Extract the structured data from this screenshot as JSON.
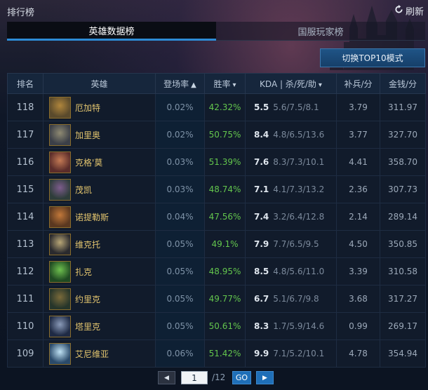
{
  "header": {
    "title": "排行榜",
    "refresh_label": "刷新"
  },
  "tabs": [
    {
      "label": "英雄数据榜",
      "active": true
    },
    {
      "label": "国服玩家榜",
      "active": false
    }
  ],
  "toggle_button": {
    "label": "切换TOP10模式"
  },
  "table": {
    "columns": {
      "rank": "排名",
      "hero": "英雄",
      "appear": "登场率",
      "win": "胜率",
      "kda": "KDA | 杀/死/助",
      "cs": "补兵/分",
      "gold": "金钱/分"
    },
    "rows": [
      {
        "rank": "118",
        "hero": "厄加特",
        "appear": "0.02%",
        "win": "42.32%",
        "kda": "5.5",
        "ksd": "5.6/7.5/8.1",
        "cs": "3.79",
        "gold": "311.97",
        "colors": [
          "#5a4a2c",
          "#b0863c"
        ]
      },
      {
        "rank": "117",
        "hero": "加里奥",
        "appear": "0.02%",
        "win": "50.75%",
        "kda": "8.4",
        "ksd": "4.8/6.5/13.6",
        "cs": "3.77",
        "gold": "327.70",
        "colors": [
          "#3b3f48",
          "#8f8a72"
        ]
      },
      {
        "rank": "116",
        "hero": "克格'莫",
        "appear": "0.03%",
        "win": "51.39%",
        "kda": "7.6",
        "ksd": "8.3/7.3/10.1",
        "cs": "4.41",
        "gold": "358.70",
        "colors": [
          "#5a2c2a",
          "#c47a54"
        ]
      },
      {
        "rank": "115",
        "hero": "茂凯",
        "appear": "0.03%",
        "win": "48.74%",
        "kda": "7.1",
        "ksd": "4.1/7.3/13.2",
        "cs": "2.36",
        "gold": "307.73",
        "colors": [
          "#2e3d3a",
          "#7d5c8c"
        ]
      },
      {
        "rank": "114",
        "hero": "诺提勒斯",
        "appear": "0.04%",
        "win": "47.56%",
        "kda": "7.4",
        "ksd": "3.2/6.4/12.8",
        "cs": "2.14",
        "gold": "289.14",
        "colors": [
          "#5a3820",
          "#c2783a"
        ]
      },
      {
        "rank": "113",
        "hero": "维克托",
        "appear": "0.05%",
        "win": "49.1%",
        "kda": "7.9",
        "ksd": "7.7/6.5/9.5",
        "cs": "4.50",
        "gold": "350.85",
        "colors": [
          "#2a2a2e",
          "#b8a676"
        ]
      },
      {
        "rank": "112",
        "hero": "扎克",
        "appear": "0.05%",
        "win": "48.95%",
        "kda": "8.5",
        "ksd": "4.8/5.6/11.0",
        "cs": "3.39",
        "gold": "310.58",
        "colors": [
          "#1f4a22",
          "#6ec04e"
        ]
      },
      {
        "rank": "111",
        "hero": "约里克",
        "appear": "0.05%",
        "win": "49.77%",
        "kda": "6.7",
        "ksd": "5.1/6.7/9.8",
        "cs": "3.68",
        "gold": "317.27",
        "colors": [
          "#26352a",
          "#7a6a3a"
        ]
      },
      {
        "rank": "110",
        "hero": "塔里克",
        "appear": "0.05%",
        "win": "50.61%",
        "kda": "8.3",
        "ksd": "1.7/5.9/14.6",
        "cs": "0.99",
        "gold": "269.17",
        "colors": [
          "#1e2a44",
          "#8a9ab8"
        ]
      },
      {
        "rank": "109",
        "hero": "艾尼维亚",
        "appear": "0.06%",
        "win": "51.42%",
        "kda": "9.9",
        "ksd": "7.1/5.2/10.1",
        "cs": "4.78",
        "gold": "354.94",
        "colors": [
          "#2a4a6a",
          "#bfe2f4"
        ]
      }
    ]
  },
  "pager": {
    "current_page": "1",
    "total": "/12",
    "go_label": "GO"
  }
}
